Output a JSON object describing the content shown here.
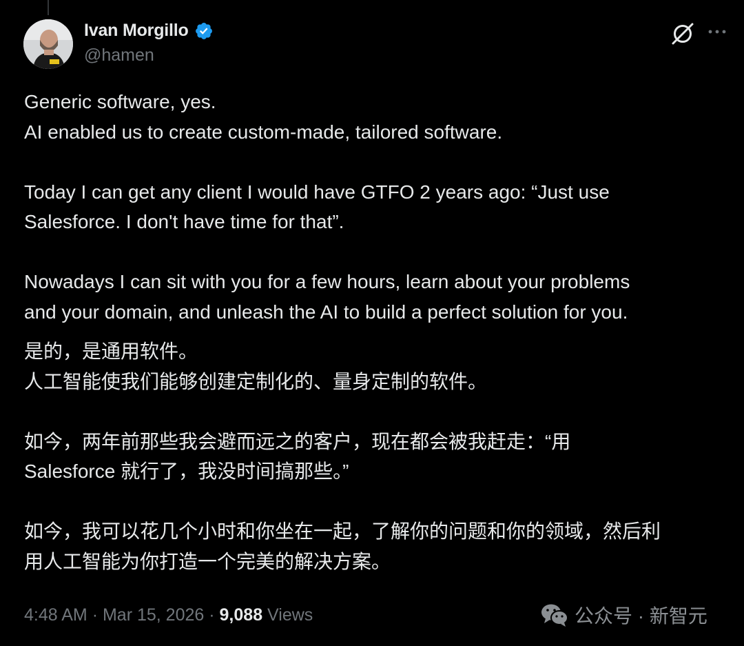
{
  "author": {
    "display_name": "Ivan Morgillo",
    "handle": "@hamen",
    "verified": true
  },
  "icons": {
    "avatar": "profile-photo",
    "verified": "verified-badge-icon",
    "grok": "grok-icon",
    "more": "more-options-icon",
    "wechat": "wechat-icon"
  },
  "tweet": {
    "en_paragraphs": [
      [
        "Generic software, yes.",
        "AI enabled us to create custom-made, tailored software."
      ],
      [
        "Today I can get any client I would have GTFO 2 years ago: “Just use",
        "Salesforce. I don't have time for that”."
      ],
      [
        "Nowadays I can sit with you for a few hours, learn about your problems",
        "and your domain, and unleash the AI to build a perfect solution for you."
      ]
    ],
    "zh_paragraphs": [
      [
        "是的，是通用软件。",
        "人工智能使我们能够创建定制化的、量身定制的软件。"
      ],
      [
        "如今，两年前那些我会避而远之的客户，现在都会被我赶走：“用",
        "Salesforce 就行了，我没时间搞那些。”"
      ],
      [
        "如今，我可以花几个小时和你坐在一起，了解你的问题和你的领域，然后利",
        "用人工智能为你打造一个完美的解决方案。"
      ]
    ]
  },
  "meta": {
    "time": "4:48 AM",
    "separator": "·",
    "date": "Mar 15, 2026",
    "views_count": "9,088",
    "views_label": "Views"
  },
  "watermark": {
    "text": "公众号 · 新智元"
  },
  "colors": {
    "background": "#000000",
    "text_primary": "#e7e9ea",
    "text_secondary": "#71767b",
    "verified_blue": "#1d9bf0"
  }
}
